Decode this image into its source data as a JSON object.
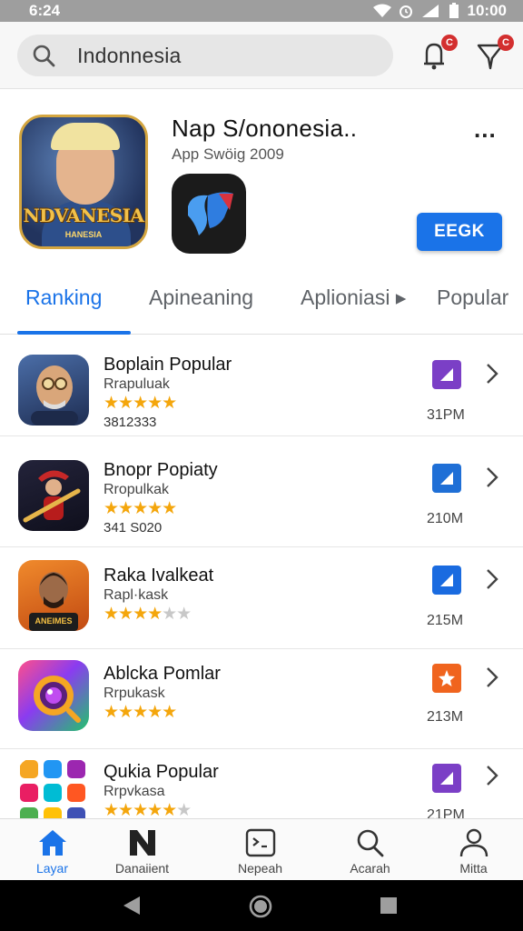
{
  "status_bar": {
    "time_left": "6:24",
    "time_right": "10:00"
  },
  "search": {
    "query": "Indonnesia"
  },
  "header": {
    "notification_badge": "C",
    "filter_badge": "C"
  },
  "featured": {
    "icon_title": "NDVANESIA",
    "icon_subtitle": "HANESIA",
    "title": "Nap S/ononesia..",
    "subtitle": "App Swöig 2009",
    "more_label": "...",
    "install_label": "EEGK"
  },
  "tabs": [
    {
      "label": "Ranking",
      "active": true
    },
    {
      "label": "Apineaning",
      "active": false
    },
    {
      "label": "Aplioniasi ▸",
      "active": false
    },
    {
      "label": "Popular",
      "active": false
    }
  ],
  "apps": [
    {
      "name": "Boplain Popular",
      "category": "Rrapuluak",
      "rating": 4.5,
      "count": "3812333",
      "size": "31PM",
      "badge_color": "#7b3fc6",
      "icon": "old-man-portrait-icon"
    },
    {
      "name": "Bnopr Popiaty",
      "category": "Rropulkak",
      "rating": 4.5,
      "count": "341 S020",
      "size": "210M",
      "badge_color": "#1f6fd6",
      "icon": "guitar-player-icon"
    },
    {
      "name": "Raka Ivalkeat",
      "category": "Rapl·kask",
      "rating": 4,
      "count": "",
      "size": "215M",
      "badge_color": "#1a6be0",
      "icon": "man-portrait-icon",
      "icon_text": "ANEIMES"
    },
    {
      "name": "Ablcka Pomlar",
      "category": "Rrpukask",
      "rating": 4.5,
      "count": "",
      "size": "213M",
      "badge_color": "#f0641e",
      "icon": "camera-lens-icon"
    },
    {
      "name": "Qukia Popular",
      "category": "Rrpvkasa",
      "rating": 4,
      "count": "",
      "size": "21PM",
      "badge_color": "#7b3fc6",
      "icon": "app-grid-icon"
    }
  ],
  "bottom_nav": [
    {
      "label": "Layar",
      "icon": "home-icon",
      "active": true
    },
    {
      "label": "Danaiient",
      "icon": "n-logo-icon",
      "active": false
    },
    {
      "label": "Nepeah",
      "icon": "terminal-icon",
      "active": false
    },
    {
      "label": "Acarah",
      "icon": "search-icon",
      "active": false
    },
    {
      "label": "Mitta",
      "icon": "person-icon",
      "active": false
    }
  ],
  "colors": {
    "accent": "#1a73e8",
    "star": "#f4a60c"
  }
}
